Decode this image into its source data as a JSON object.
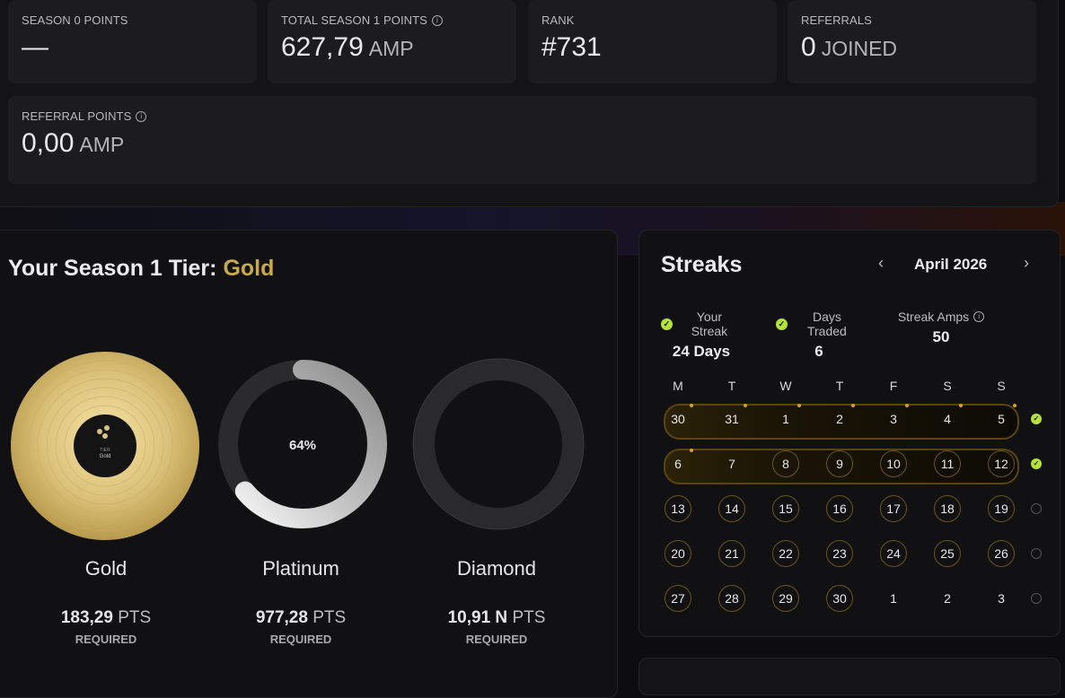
{
  "stats": {
    "season0": {
      "label": "SEASON 0 POINTS",
      "value": "—"
    },
    "season1": {
      "label": "TOTAL SEASON 1 POINTS",
      "value": "627,79",
      "unit": "AMP"
    },
    "rank": {
      "label": "RANK",
      "value": "#731"
    },
    "referrals": {
      "label": "REFERRALS",
      "value": "0",
      "unit": "JOINED"
    },
    "referral_points": {
      "label": "REFERRAL POINTS",
      "value": "0,00",
      "unit": "AMP"
    }
  },
  "tier": {
    "title": "Your Season 1 Tier:",
    "current": "Gold",
    "items": [
      {
        "name": "Gold",
        "pts": "183,29",
        "unit": "PTS",
        "req": "REQUIRED"
      },
      {
        "name": "Platinum",
        "pts": "977,28",
        "unit": "PTS",
        "req": "REQUIRED",
        "progress_label": "64%",
        "progress": 0.64
      },
      {
        "name": "Diamond",
        "pts": "10,91 N",
        "unit": "PTS",
        "req": "REQUIRED"
      }
    ],
    "record_label_line1": "TIER",
    "record_label_line2": "Gold"
  },
  "streaks": {
    "title": "Streaks",
    "month": "April 2026",
    "your_streak": {
      "label": "Your Streak",
      "value": "24 Days"
    },
    "days_traded": {
      "label": "Days Traded",
      "value": "6"
    },
    "streak_amps": {
      "label": "Streak Amps",
      "value": "50"
    },
    "weekdays": [
      "M",
      "T",
      "W",
      "T",
      "F",
      "S",
      "S"
    ],
    "weeks": [
      [
        "30",
        "31",
        "1",
        "2",
        "3",
        "4",
        "5"
      ],
      [
        "6",
        "7",
        "8",
        "9",
        "10",
        "11",
        "12"
      ],
      [
        "13",
        "14",
        "15",
        "16",
        "17",
        "18",
        "19"
      ],
      [
        "20",
        "21",
        "22",
        "23",
        "24",
        "25",
        "26"
      ],
      [
        "27",
        "28",
        "29",
        "30",
        "1",
        "2",
        "3"
      ]
    ],
    "week_complete": [
      true,
      true,
      false,
      false,
      false
    ]
  },
  "colors": {
    "accent_green": "#b6e33a",
    "gold": "#c9a94d",
    "gold_dot": "#d6a21e"
  }
}
